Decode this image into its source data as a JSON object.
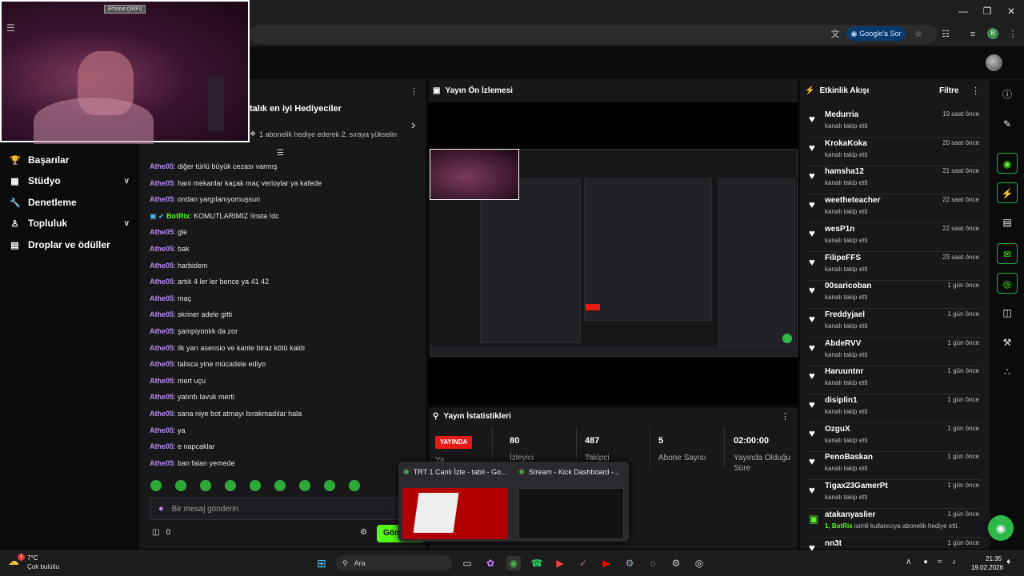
{
  "browser": {
    "ask_google_label": "Google'a Sor",
    "profile_initial": "B"
  },
  "webcam": {
    "source_label": "iPhone (WiFi)"
  },
  "sidebar": {
    "items": [
      {
        "label": "Başarılar",
        "icon": "trophy-icon",
        "has_chevron": false
      },
      {
        "label": "Stüdyo",
        "icon": "studio-icon",
        "has_chevron": true
      },
      {
        "label": "Denetleme",
        "icon": "wrench-icon",
        "has_chevron": false
      },
      {
        "label": "Topluluk",
        "icon": "community-icon",
        "has_chevron": true
      },
      {
        "label": "Droplar ve ödüller",
        "icon": "drops-icon",
        "has_chevron": false
      }
    ]
  },
  "chat": {
    "header_title": "talık en iyi Hediyeciler",
    "header_sub": "1 abonelik hediye ederek 2. sıraya yükselin",
    "messages": [
      {
        "user": "Athe05",
        "text": "diğer türlü büyük cezası varmış"
      },
      {
        "user": "Athe05",
        "text": "hani mekanlar kaçak maç verioylar ya kafede"
      },
      {
        "user": "Athe05",
        "text": "ondan yargılanıyomuşsun"
      },
      {
        "user": "BotRix",
        "text": "KOMUTLARIMIZ !insta !dc",
        "bot": true
      },
      {
        "user": "Athe05",
        "text": "gle"
      },
      {
        "user": "Athe05",
        "text": "bak"
      },
      {
        "user": "Athe05",
        "text": "harbidem"
      },
      {
        "user": "Athe05",
        "text": "artık 4 ler ler bence ya 41 42"
      },
      {
        "user": "Athe05",
        "text": "maç"
      },
      {
        "user": "Athe05",
        "text": "skriner adele gitti"
      },
      {
        "user": "Athe05",
        "text": "şampiyonlık da zor"
      },
      {
        "user": "Athe05",
        "text": "ilk yarı asensio ve kante biraz kötü kaldı"
      },
      {
        "user": "Athe05",
        "text": "talisca yine mücadele ediyo"
      },
      {
        "user": "Athe05",
        "text": "mert uçu"
      },
      {
        "user": "Athe05",
        "text": "yatırdı lavuk merti"
      },
      {
        "user": "Athe05",
        "text": "sana niye bot atmayı bırakmadılar hala"
      },
      {
        "user": "Athe05",
        "text": "ya"
      },
      {
        "user": "Athe05",
        "text": "e napcaklar"
      },
      {
        "user": "Athe05",
        "text": "ban falan yemede"
      }
    ],
    "input_placeholder": "Bir mesaj gönderin",
    "gift_count": "0",
    "send_label": "Gön"
  },
  "preview": {
    "title": "Yayın Ön İzlemesi"
  },
  "stats": {
    "title": "Yayın İstatistikleri",
    "live_badge": "YAYINDA",
    "items": [
      {
        "value": "80",
        "label": "İzleyici"
      },
      {
        "value": "487",
        "label": "Takipçi"
      },
      {
        "value": "5",
        "label": "Abone Sayısı"
      },
      {
        "value": "02:00:00",
        "label": "Yayında Olduğu Süre"
      }
    ],
    "hidden_label": "Ya"
  },
  "thumbs": [
    {
      "title": "TRT 1 Canlı İzle - tabii - Go..."
    },
    {
      "title": "Stream - Kick Dashboard -..."
    }
  ],
  "activity": {
    "title": "Etkinlik Akışı",
    "filter_label": "Filtre",
    "items": [
      {
        "name": "Medurria",
        "desc": "kanalı takip etti",
        "time": "19 saat önce"
      },
      {
        "name": "KrokaKoka",
        "desc": "kanalı takip etti",
        "time": "20 saat önce"
      },
      {
        "name": "hamsha12",
        "desc": "kanalı takip etti",
        "time": "21 saat önce"
      },
      {
        "name": "weetheteacher",
        "desc": "kanalı takip etti",
        "time": "22 saat önce"
      },
      {
        "name": "wesP1n",
        "desc": "kanalı takip etti",
        "time": "22 saat önce"
      },
      {
        "name": "FilipeFFS",
        "desc": "kanalı takip etti",
        "time": "23 saat önce"
      },
      {
        "name": "00saricoban",
        "desc": "kanalı takip etti",
        "time": "1 gün önce"
      },
      {
        "name": "Freddyjael",
        "desc": "kanalı takip etti",
        "time": "1 gün önce"
      },
      {
        "name": "AbdeRVV",
        "desc": "kanalı takip etti",
        "time": "1 gün önce"
      },
      {
        "name": "Haruuntnr",
        "desc": "kanalı takip etti",
        "time": "1 gün önce"
      },
      {
        "name": "disiplin1",
        "desc": "kanalı takip etti",
        "time": "1 gün önce"
      },
      {
        "name": "OzguX",
        "desc": "kanalı takip etti",
        "time": "1 gün önce"
      },
      {
        "name": "PenoBaskan",
        "desc": "kanalı takip etti",
        "time": "1 gün önce"
      },
      {
        "name": "Tigax23GamerPt",
        "desc": "kanalı takip etti",
        "time": "1 gün önce"
      },
      {
        "name": "atakanyaslier",
        "desc_prefix": "1, ",
        "desc_hl": "BotRix",
        "desc_suffix": " isimli kullanıcıya abonelik hediye etti.",
        "time": "1 gün önce",
        "gift": true
      },
      {
        "name": "nn3t",
        "desc": "",
        "time": "1 gün önce"
      }
    ]
  },
  "taskbar": {
    "weather_temp": "7°C",
    "weather_desc": "Çok bulutlu",
    "search_placeholder": "Ara",
    "clock_time": "21:35",
    "clock_date": "19.02.2026",
    "weather_badge": "1"
  },
  "colors": {
    "brand_green": "#53fc18",
    "username_purple": "#b58cf0",
    "live_red": "#e91916"
  }
}
